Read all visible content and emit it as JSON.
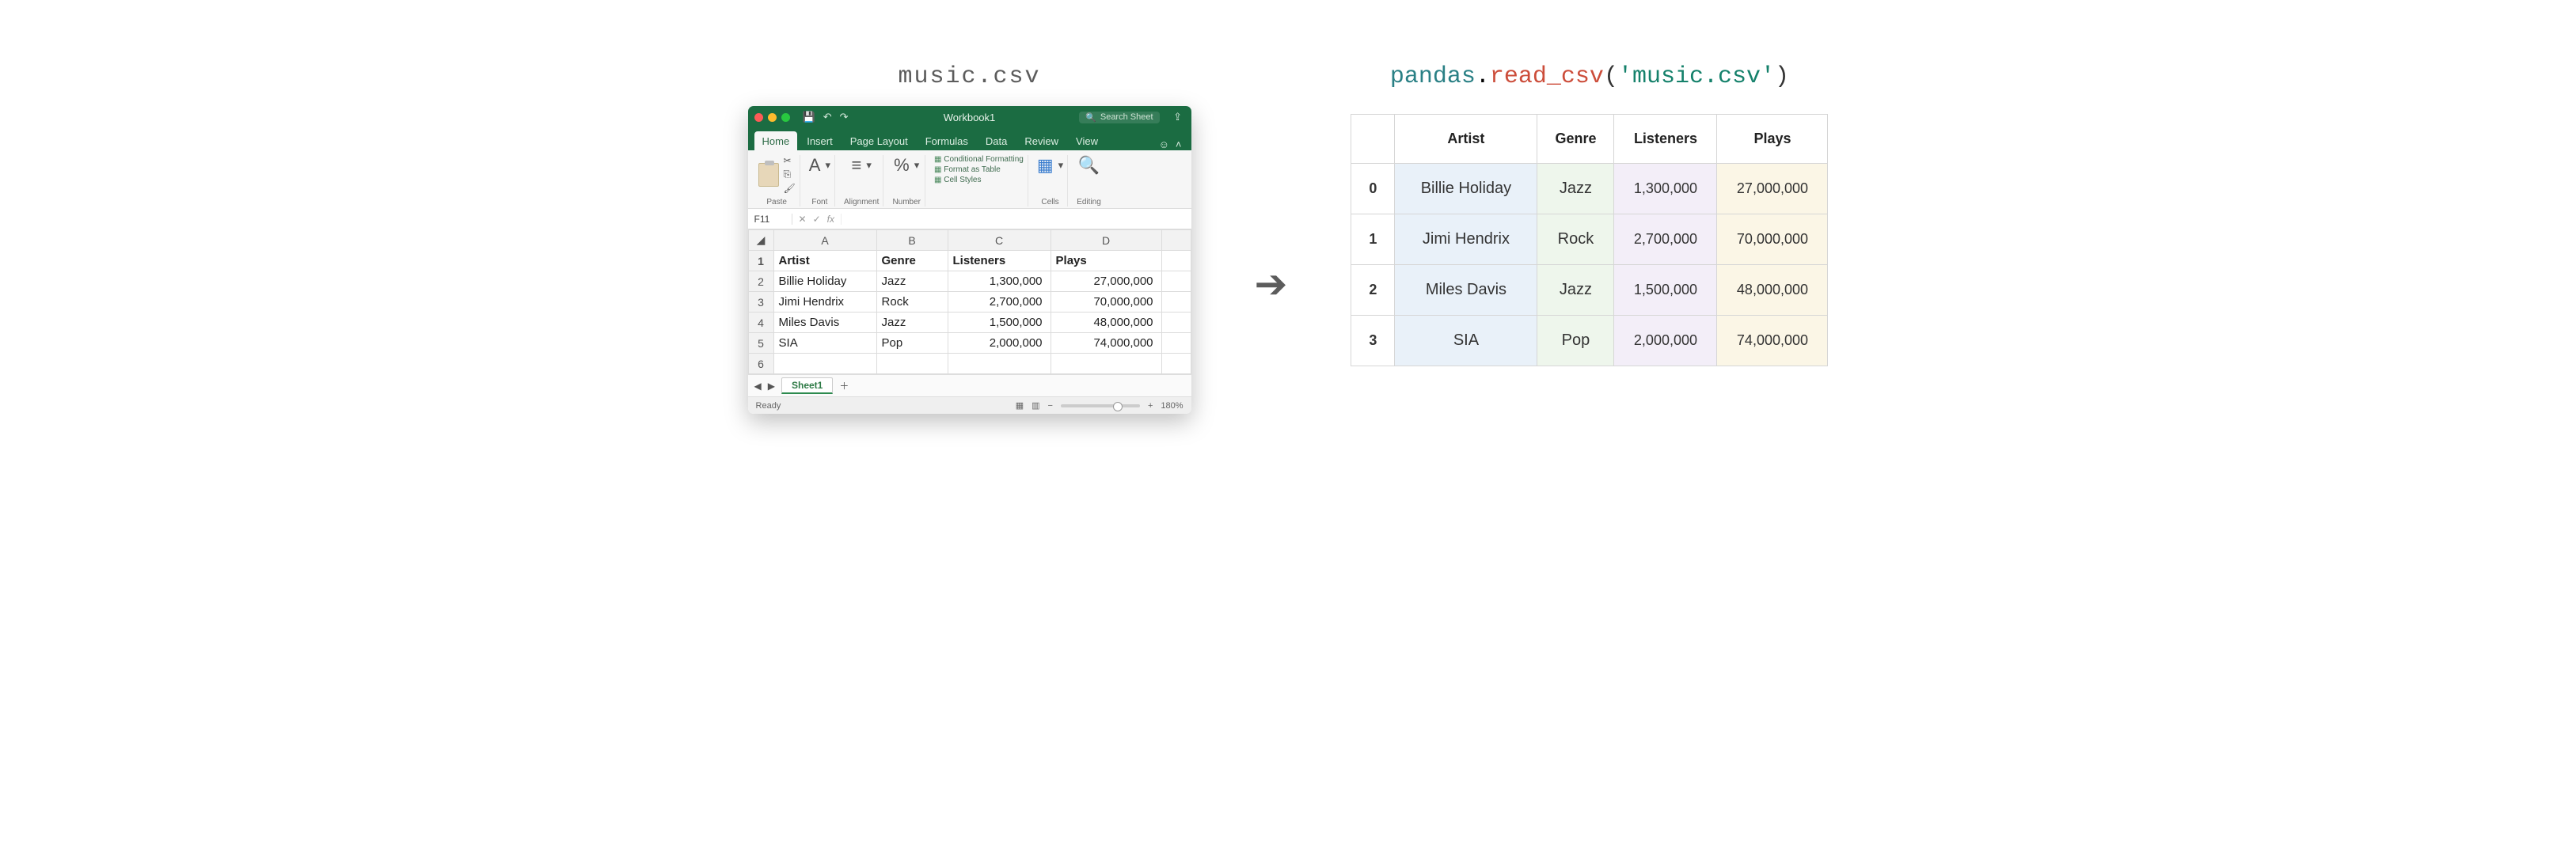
{
  "left_title": "music.csv",
  "right_title": {
    "ns": "pandas",
    "dot": ".",
    "fn": "read_csv",
    "open": "(",
    "arg": "'music.csv'",
    "close": ")"
  },
  "excel": {
    "workbook_title": "Workbook1",
    "search_placeholder": "Search Sheet",
    "tabs": [
      "Home",
      "Insert",
      "Page Layout",
      "Formulas",
      "Data",
      "Review",
      "View"
    ],
    "active_tab": "Home",
    "ribbon_groups": {
      "paste": "Paste",
      "font": "Font",
      "alignment": "Alignment",
      "number": "Number",
      "styles_label": "",
      "styles_items": [
        "Conditional Formatting",
        "Format as Table",
        "Cell Styles"
      ],
      "cells": "Cells",
      "editing": "Editing"
    },
    "namebox": "F11",
    "fx_label": "fx",
    "columns": [
      "A",
      "B",
      "C",
      "D"
    ],
    "header_row": [
      "Artist",
      "Genre",
      "Listeners",
      "Plays"
    ],
    "rows": [
      [
        "Billie Holiday",
        "Jazz",
        "1,300,000",
        "27,000,000"
      ],
      [
        "Jimi Hendrix",
        "Rock",
        "2,700,000",
        "70,000,000"
      ],
      [
        "Miles Davis",
        "Jazz",
        "1,500,000",
        "48,000,000"
      ],
      [
        "SIA",
        "Pop",
        "2,000,000",
        "74,000,000"
      ]
    ],
    "row_numbers": [
      "1",
      "2",
      "3",
      "4",
      "5",
      "6"
    ],
    "sheet_tab": "Sheet1",
    "status_ready": "Ready",
    "zoom": "180%"
  },
  "arrow": "➔",
  "dataframe": {
    "columns": [
      "Artist",
      "Genre",
      "Listeners",
      "Plays"
    ],
    "index": [
      "0",
      "1",
      "2",
      "3"
    ],
    "data": [
      {
        "Artist": "Billie Holiday",
        "Genre": "Jazz",
        "Listeners": "1,300,000",
        "Plays": "27,000,000"
      },
      {
        "Artist": "Jimi Hendrix",
        "Genre": "Rock",
        "Listeners": "2,700,000",
        "Plays": "70,000,000"
      },
      {
        "Artist": "Miles Davis",
        "Genre": "Jazz",
        "Listeners": "1,500,000",
        "Plays": "48,000,000"
      },
      {
        "Artist": "SIA",
        "Genre": "Pop",
        "Listeners": "2,000,000",
        "Plays": "74,000,000"
      }
    ]
  },
  "chart_data": {
    "type": "table",
    "columns": [
      "Artist",
      "Genre",
      "Listeners",
      "Plays"
    ],
    "rows": [
      [
        "Billie Holiday",
        "Jazz",
        1300000,
        27000000
      ],
      [
        "Jimi Hendrix",
        "Rock",
        2700000,
        70000000
      ],
      [
        "Miles Davis",
        "Jazz",
        1500000,
        48000000
      ],
      [
        "SIA",
        "Pop",
        2000000,
        74000000
      ]
    ],
    "title": "music.csv loaded via pandas.read_csv"
  }
}
